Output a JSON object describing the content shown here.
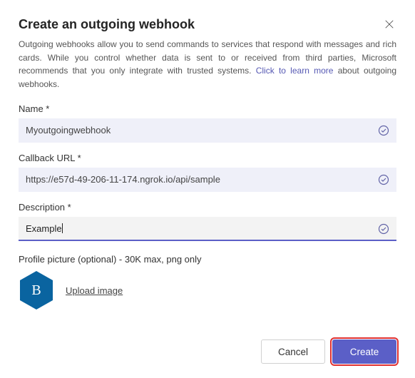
{
  "dialog": {
    "title": "Create an outgoing webhook",
    "description_pre": "Outgoing webhooks allow you to send commands to services that respond with messages and rich cards. While you control whether data is sent to or received from third parties, Microsoft recommends that you only integrate with trusted systems. ",
    "learn_more": "Click to learn more",
    "description_post": " about outgoing webhooks."
  },
  "form": {
    "name": {
      "label": "Name *",
      "value": "Myoutgoingwebhook"
    },
    "callback": {
      "label": "Callback URL *",
      "value": "https://e57d-49-206-11-174.ngrok.io/api/sample"
    },
    "description_field": {
      "label": "Description *",
      "value": "Example"
    },
    "profile": {
      "label": "Profile picture (optional) - 30K max, png only",
      "upload_label": "Upload image",
      "avatar_letter": "B"
    }
  },
  "buttons": {
    "cancel": "Cancel",
    "create": "Create"
  },
  "colors": {
    "primary": "#5b5fc7",
    "avatar_bg": "#0a64a0"
  }
}
